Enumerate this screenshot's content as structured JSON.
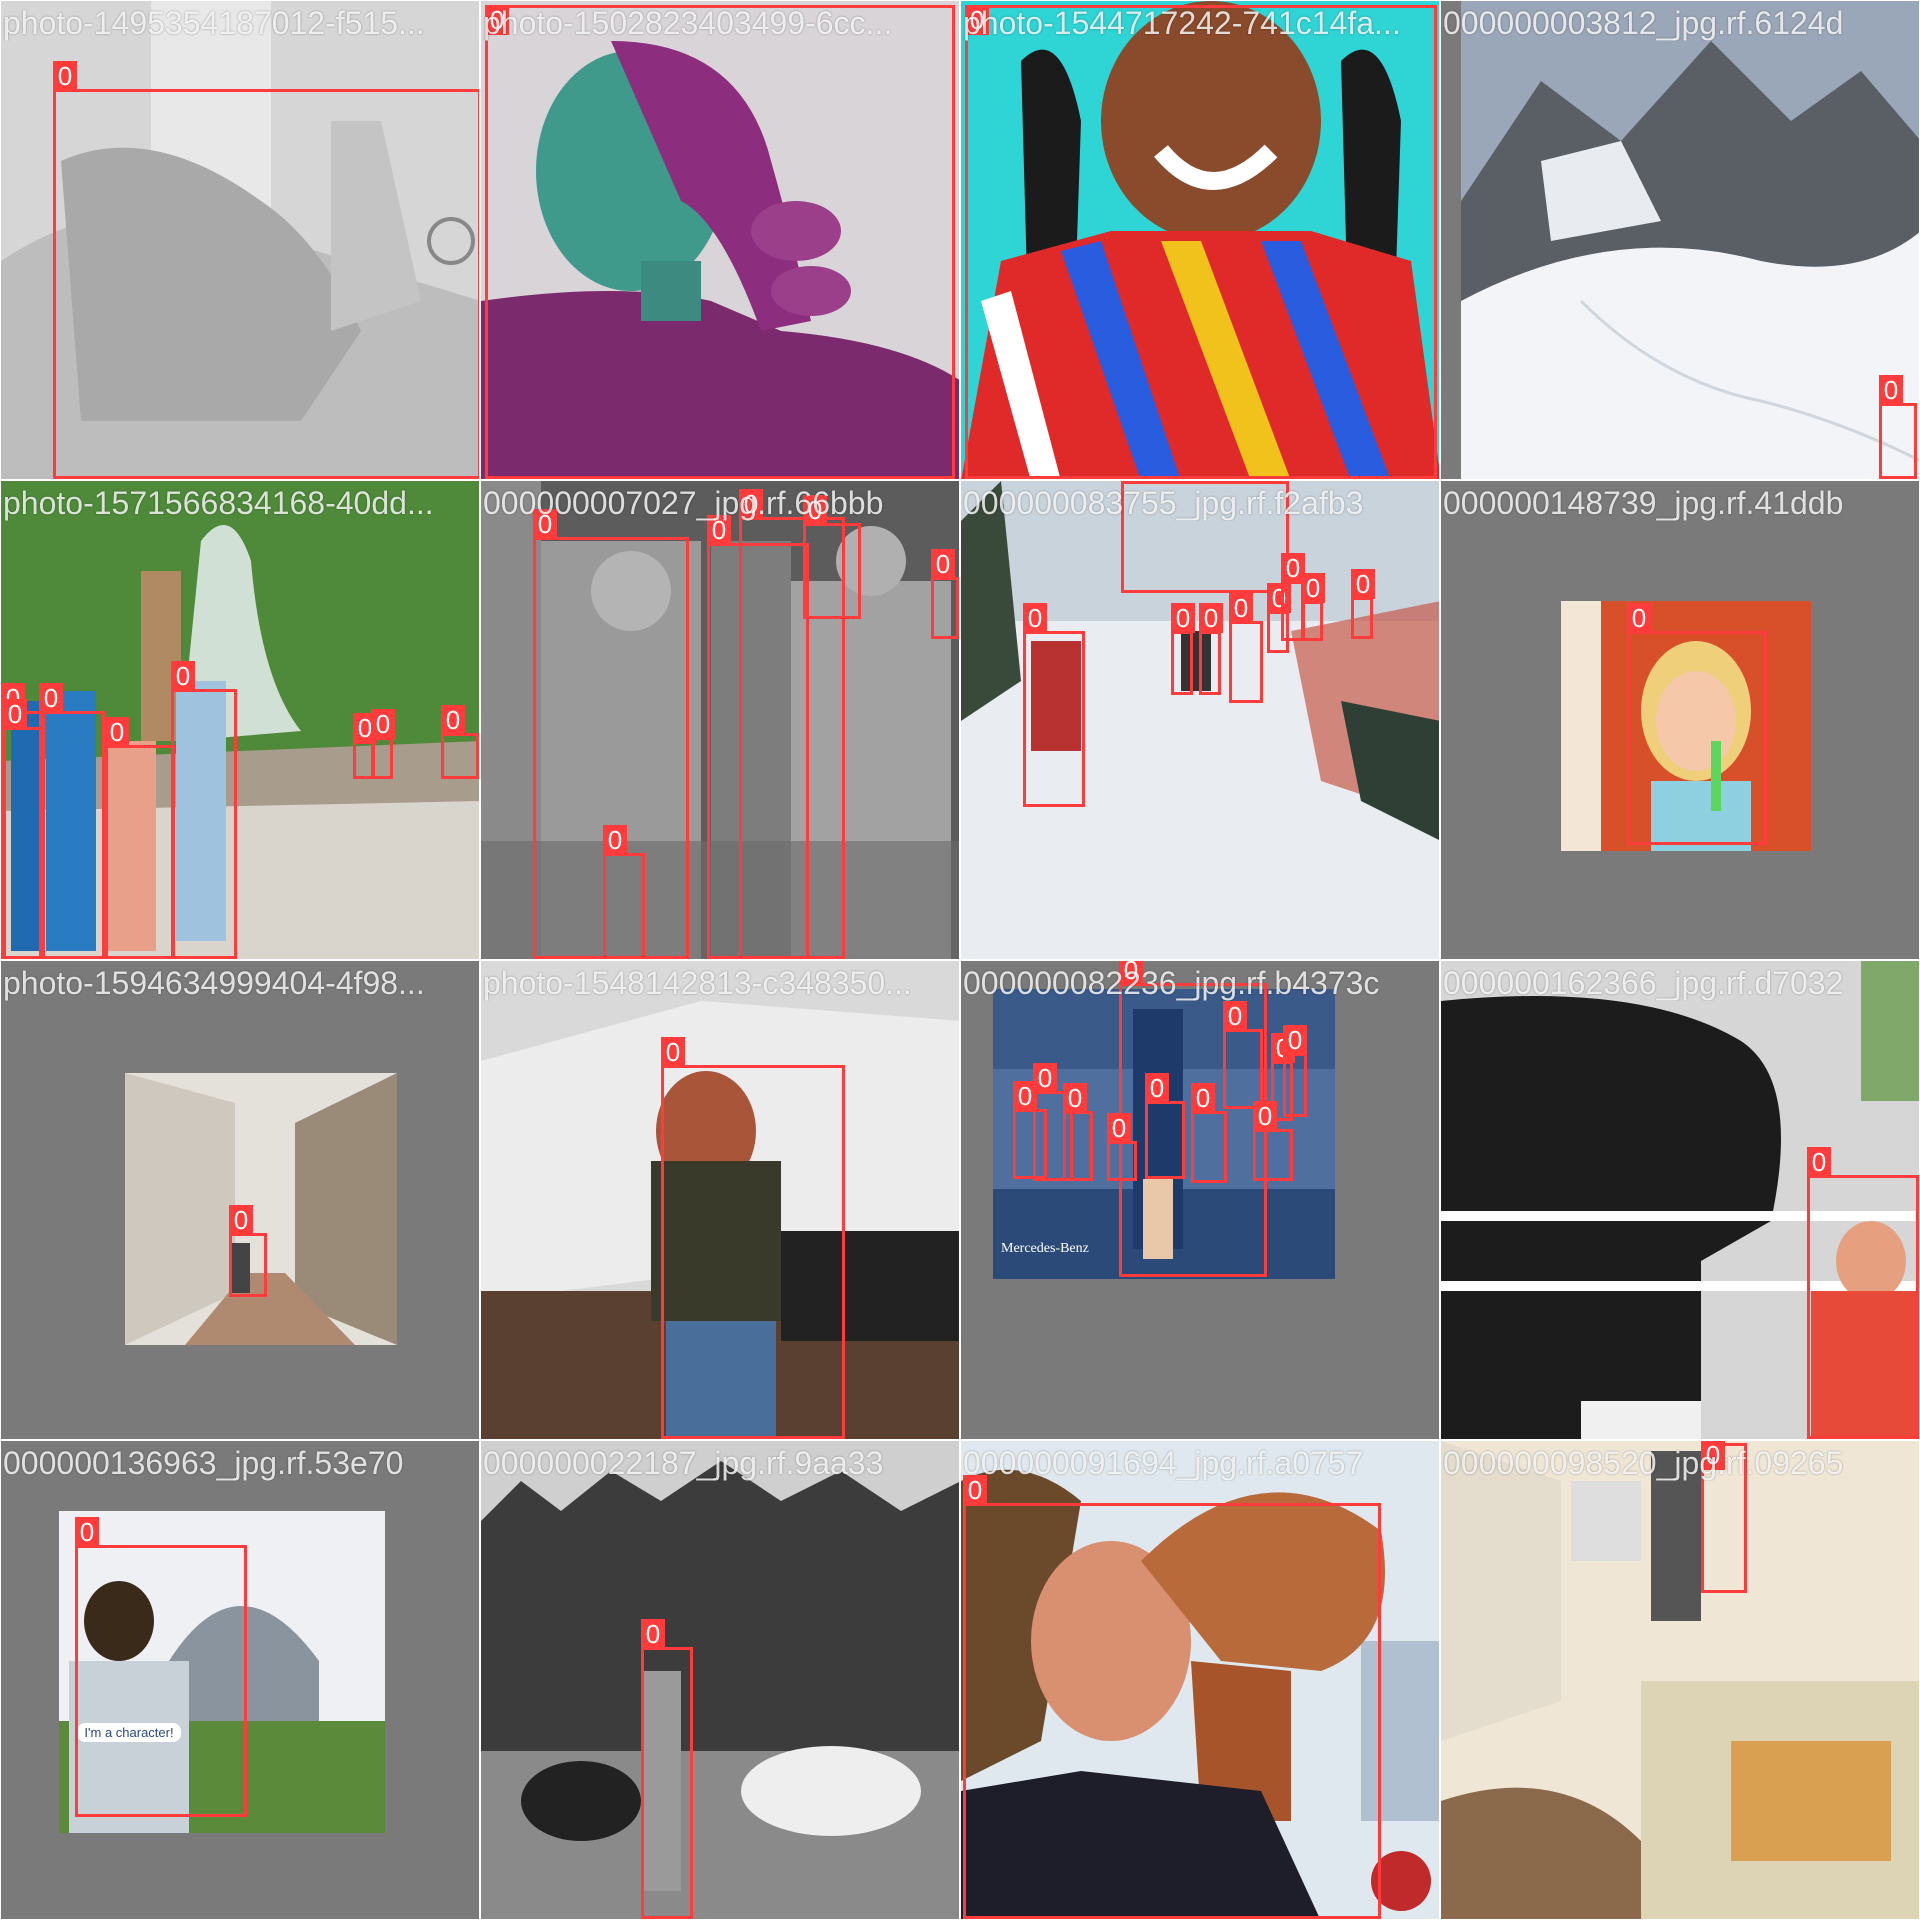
{
  "colors": {
    "box": "#ff3b3b",
    "label_bg": "#ff3b3b",
    "label_text": "#ffffff",
    "title_text": "#ffffff",
    "letterbox": "#7a7a7a"
  },
  "tiles": [
    {
      "title": "photo-1495354187012-f515...",
      "boxes": [
        {
          "label": "0"
        }
      ]
    },
    {
      "title": "photo-1502823403499-6cc...",
      "boxes": [
        {
          "label": "0"
        }
      ]
    },
    {
      "title": "photo-1544717242-741c14fa...",
      "boxes": [
        {
          "label": "0"
        }
      ]
    },
    {
      "title": "000000003812_jpg.rf.6124d",
      "boxes": [
        {
          "label": "0"
        }
      ]
    },
    {
      "title": "photo-1571566834168-40dd...",
      "boxes": [
        {
          "label": "0"
        },
        {
          "label": "0"
        },
        {
          "label": "0"
        },
        {
          "label": "0"
        },
        {
          "label": "0"
        },
        {
          "label": "0"
        },
        {
          "label": "0"
        },
        {
          "label": "0"
        }
      ]
    },
    {
      "title": "000000007027_jpg.rf.66bbb",
      "boxes": [
        {
          "label": "0"
        },
        {
          "label": "0"
        },
        {
          "label": "0"
        },
        {
          "label": "0"
        },
        {
          "label": "0"
        },
        {
          "label": "0"
        }
      ]
    },
    {
      "title": "000000083755_jpg.rf.f2afb3",
      "boxes": [
        {
          "label": "0"
        },
        {
          "label": "0"
        },
        {
          "label": "0"
        },
        {
          "label": "0"
        },
        {
          "label": "0"
        },
        {
          "label": "0"
        },
        {
          "label": "0"
        },
        {
          "label": "0"
        },
        {
          "label": "0"
        }
      ]
    },
    {
      "title": "000000148739_jpg.rf.41ddb",
      "boxes": [
        {
          "label": "0"
        }
      ]
    },
    {
      "title": "photo-1594634999404-4f98...",
      "boxes": [
        {
          "label": "0"
        }
      ]
    },
    {
      "title": "photo-1548142813-c348350...",
      "boxes": [
        {
          "label": "0"
        }
      ]
    },
    {
      "title": "000000082236_jpg.rf.b4373c",
      "boxes": [
        {
          "label": "0"
        },
        {
          "label": "0"
        },
        {
          "label": "0"
        },
        {
          "label": "0"
        },
        {
          "label": "0"
        },
        {
          "label": "0"
        },
        {
          "label": "0"
        },
        {
          "label": "0"
        },
        {
          "label": "0"
        },
        {
          "label": "0"
        },
        {
          "label": "0"
        }
      ]
    },
    {
      "title": "000000162366_jpg.rf.d7032",
      "boxes": [
        {
          "label": "0"
        }
      ]
    },
    {
      "title": "000000136963_jpg.rf.53e70",
      "boxes": [
        {
          "label": "0"
        }
      ]
    },
    {
      "title": "000000022187_jpg.rf.9aa33",
      "boxes": [
        {
          "label": "0"
        }
      ]
    },
    {
      "title": "000000091694_jpg.rf.a0757",
      "boxes": [
        {
          "label": "0"
        }
      ]
    },
    {
      "title": "000000098520_jpg.rf.09265",
      "boxes": [
        {
          "label": "0"
        }
      ]
    }
  ],
  "photo_text": {
    "sponsor": "Mercedes-Benz",
    "shirt": "I'm a character!"
  }
}
